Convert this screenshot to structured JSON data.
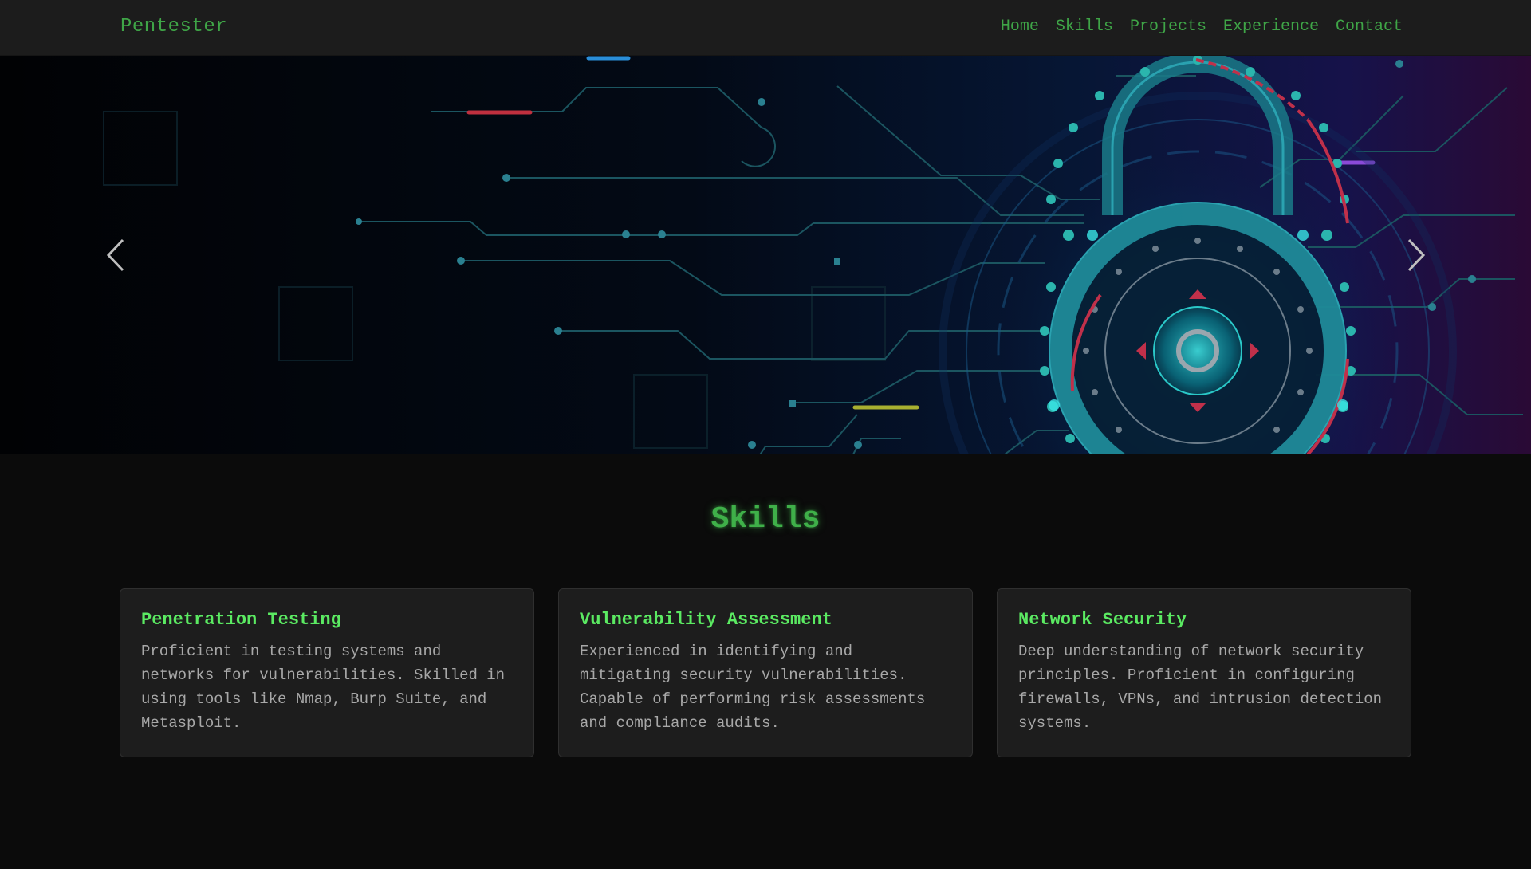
{
  "navbar": {
    "brand": "Pentester",
    "links": [
      {
        "label": "Home"
      },
      {
        "label": "Skills"
      },
      {
        "label": "Projects"
      },
      {
        "label": "Experience"
      },
      {
        "label": "Contact"
      }
    ]
  },
  "hero": {
    "image_icon": "padlock-circuit-icon",
    "prev_icon": "chevron-left-icon",
    "next_icon": "chevron-right-icon"
  },
  "skills": {
    "title": "Skills",
    "cards": [
      {
        "title": "Penetration Testing",
        "text": "Proficient in testing systems and networks for vulnerabilities. Skilled in using tools like Nmap, Burp Suite, and Metasploit."
      },
      {
        "title": "Vulnerability Assessment",
        "text": "Experienced in identifying and mitigating security vulnerabilities. Capable of performing risk assessments and compliance audits."
      },
      {
        "title": "Network Security",
        "text": "Deep understanding of network security principles. Proficient in configuring firewalls, VPNs, and intrusion detection systems."
      }
    ]
  },
  "colors": {
    "accent": "#3fa547",
    "card_title": "#5bea62",
    "nav_bg": "#1c1c1c",
    "page_bg": "#0b0b0b",
    "card_bg": "#1d1d1d"
  }
}
